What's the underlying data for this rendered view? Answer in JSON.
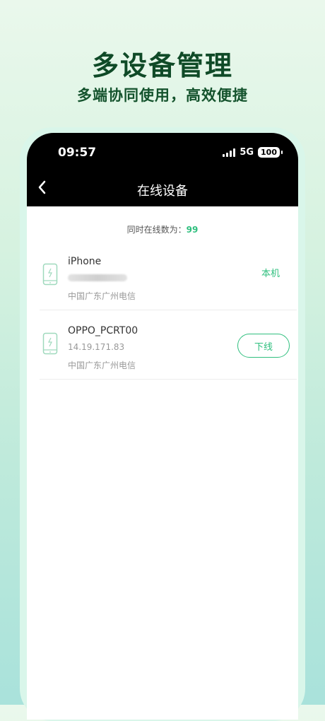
{
  "promo": {
    "title": "多设备管理",
    "subtitle": "多端协同使用，高效便捷"
  },
  "status_bar": {
    "time": "09:57",
    "network": "5G",
    "battery": "100"
  },
  "nav": {
    "title": "在线设备"
  },
  "summary": {
    "label": "同时在线数为：",
    "count": "99"
  },
  "devices": [
    {
      "name": "iPhone",
      "ip": "",
      "location": "中国广东广州电信",
      "action": "本机"
    },
    {
      "name": "OPPO_PCRT00",
      "ip": "14.19.171.83",
      "location": "中国广东广州电信",
      "action": "下线"
    }
  ],
  "colors": {
    "accent": "#2fbf7e",
    "headline": "#0f4a27",
    "topbar": "#000000"
  }
}
